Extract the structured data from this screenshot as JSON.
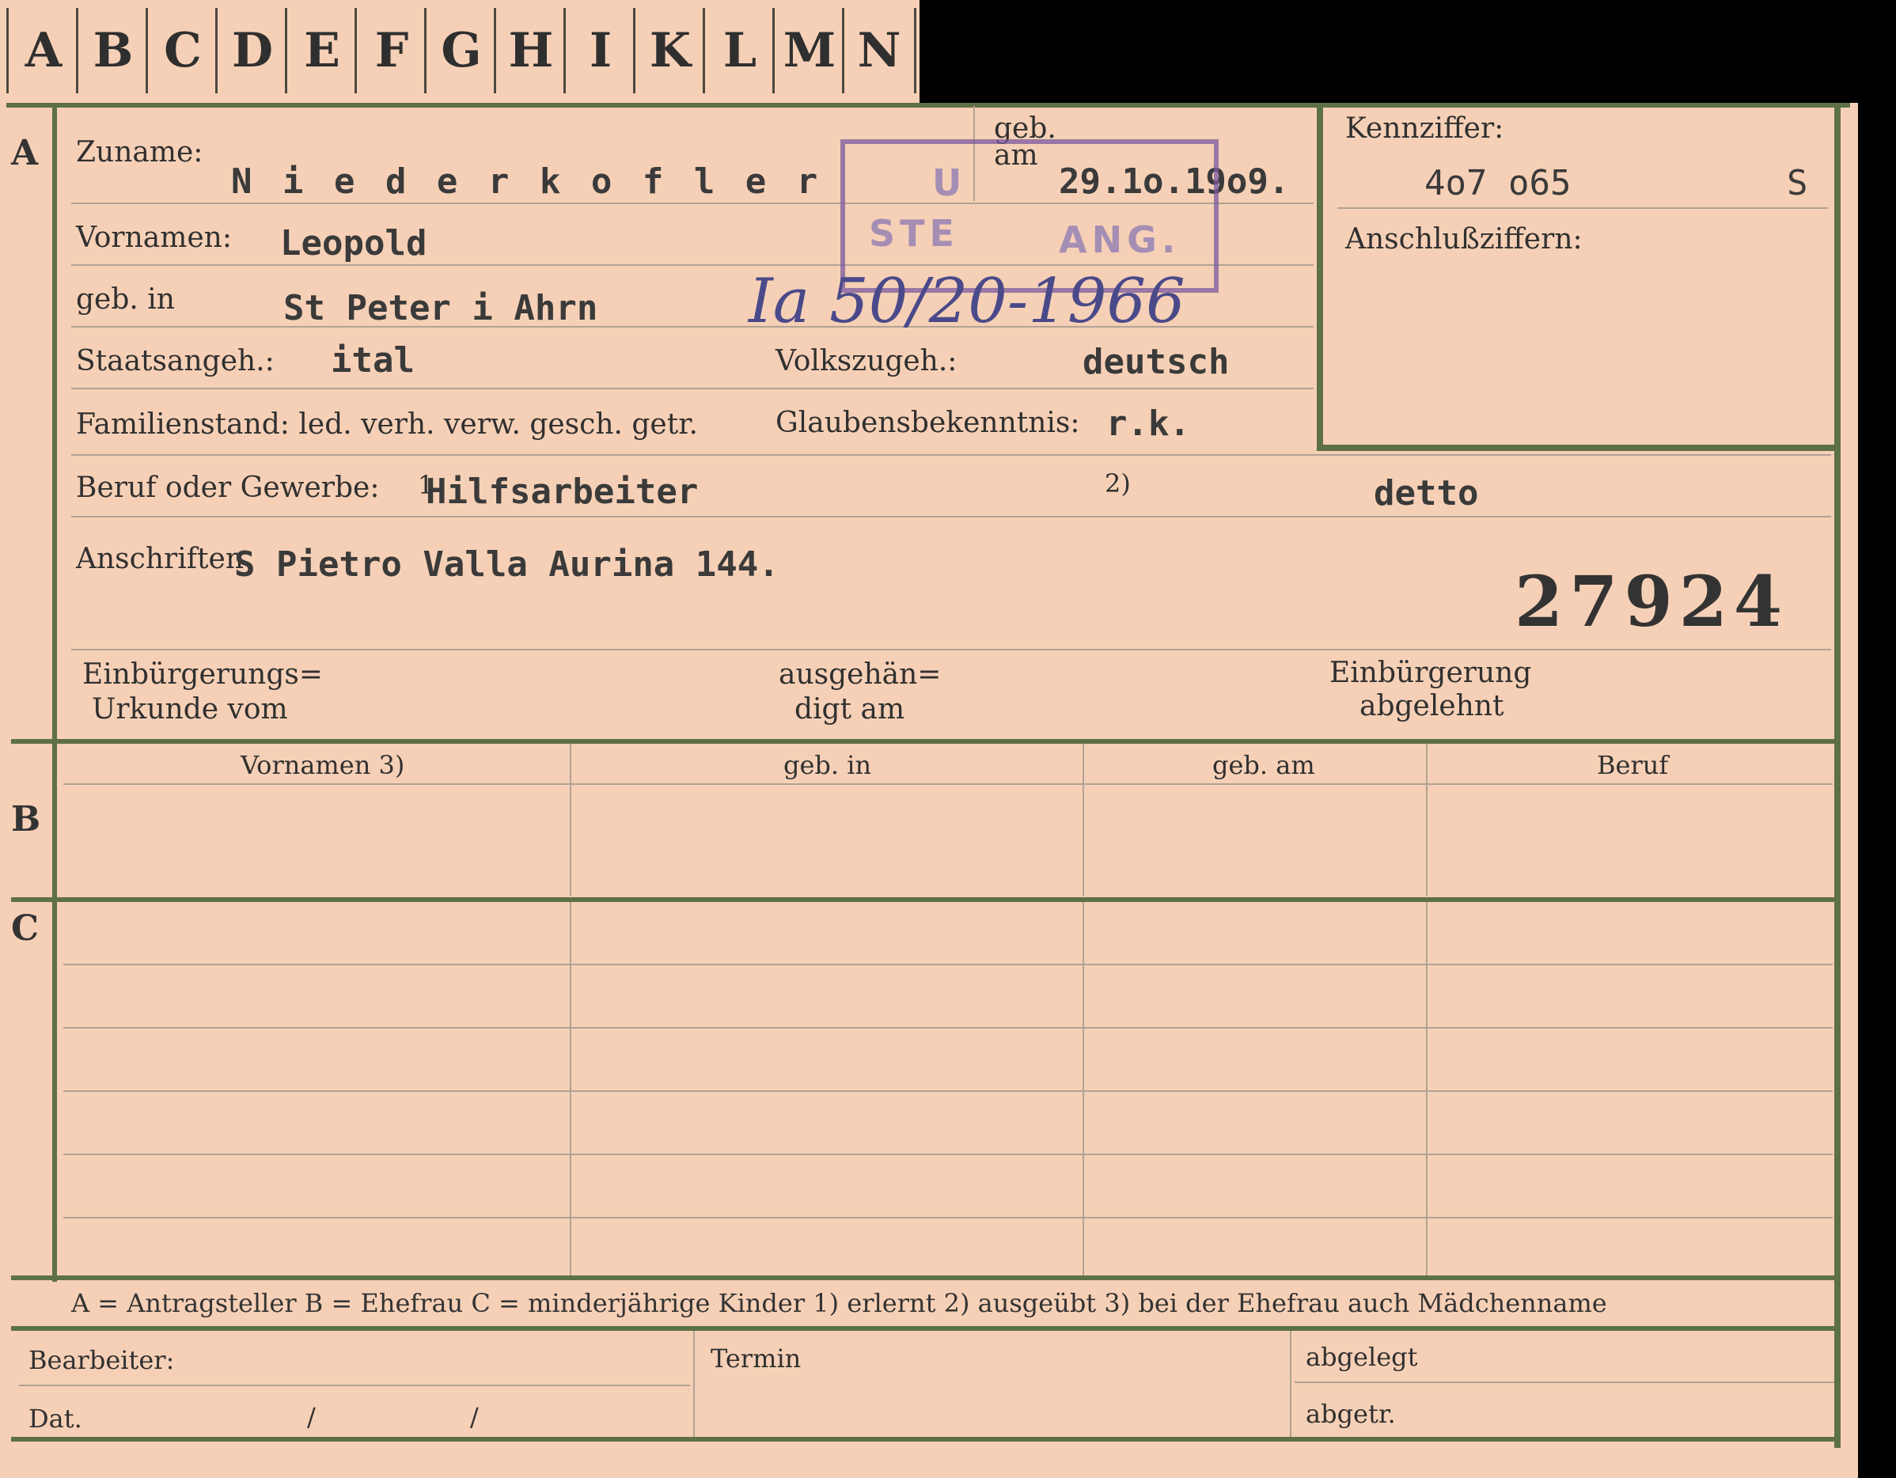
{
  "tabs": [
    "A",
    "B",
    "C",
    "D",
    "E",
    "F",
    "G",
    "H",
    "I",
    "K",
    "L",
    "M",
    "N"
  ],
  "sections": {
    "a": "A",
    "b": "B",
    "c": "C"
  },
  "labels": {
    "zuname": "Zuname:",
    "geb_am": "geb. am",
    "vornamen": "Vornamen:",
    "geb_in": "geb. in",
    "staatsangeh": "Staatsangeh.:",
    "volkszugeh": "Volkszugeh.:",
    "familienstand": "Familienstand: led. verh. verw. gesch. getr.",
    "glaubensbekenntnis": "Glaubensbekenntnis:",
    "beruf": "Beruf oder Gewerbe:",
    "fn1": "1",
    "fn2": "2)",
    "anschriften": "Anschriften",
    "kennziffer": "Kennziffer:",
    "anschlussziffern": "Anschlußziffern:",
    "einbuergerungs1": "Einbürgerungs=",
    "einbuergerungs2": "Urkunde vom",
    "ausgehaen1": "ausgehän=",
    "ausgehaen2": "digt am",
    "abgelehnt1": "Einbürgerung",
    "abgelehnt2": "abgelehnt"
  },
  "values": {
    "zuname": "N i e d e r k o f l e r",
    "geb_am": "29.1o.19o9.",
    "vornamen": "Leopold",
    "geb_in": "St Peter i Ahrn",
    "staatsangeh": "ital",
    "volkszugeh": "deutsch",
    "glaubensbekenntnis": "r.k.",
    "beruf1": "Hilfsarbeiter",
    "beruf2": "detto",
    "anschrift": "S Pietro Valla Aurina 144.",
    "kennziffer": "4o7 o65",
    "kennziffer_suffix": "S",
    "number": "27924"
  },
  "stamp": {
    "line1": "U",
    "line2": "STE",
    "line3": "ANG."
  },
  "handwritten": "Ia 50/20-1966",
  "table_headers": [
    "Vornamen 3)",
    "geb. in",
    "geb. am",
    "Beruf"
  ],
  "legend": "A = Antragsteller   B = Ehefrau   C = minderjährige Kinder   1) erlernt   2) ausgeübt   3) bei der Ehefrau auch Mädchenname",
  "footer": {
    "bearbeiter": "Bearbeiter:",
    "dat": "Dat.",
    "slash1": "/",
    "slash2": "/",
    "termin": "Termin",
    "abgelegt": "abgelegt",
    "abgetr": "abgetr."
  }
}
